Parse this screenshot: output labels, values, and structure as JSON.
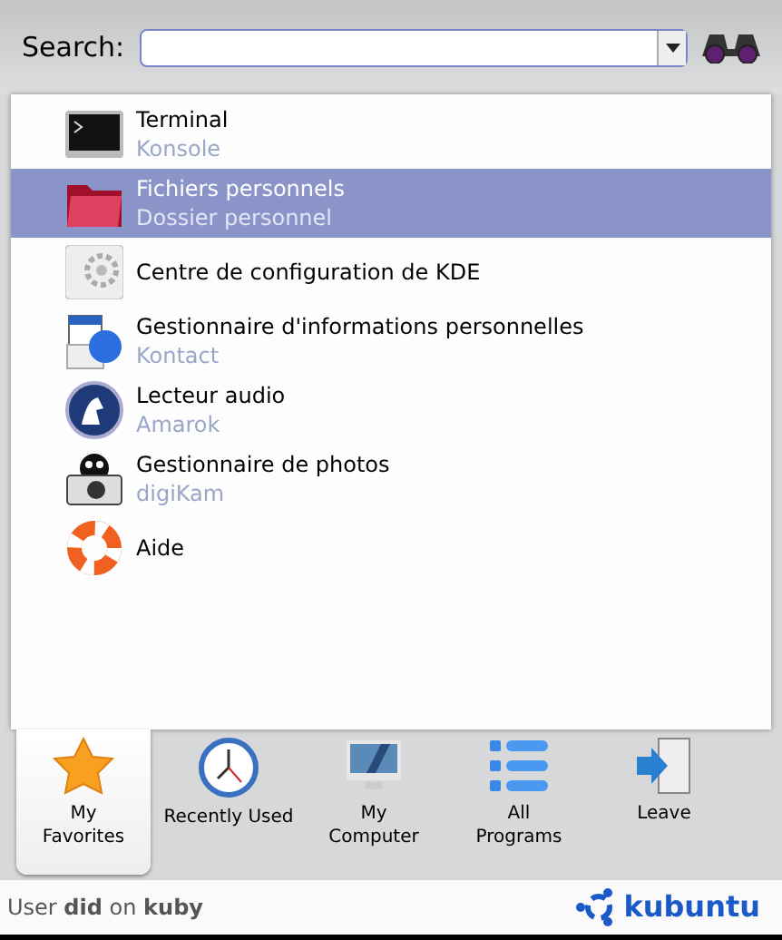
{
  "search": {
    "label": "Search:"
  },
  "items": [
    {
      "title": "Terminal",
      "subtitle": "Konsole",
      "selected": false
    },
    {
      "title": "Fichiers personnels",
      "subtitle": "Dossier personnel",
      "selected": true
    },
    {
      "title": "Centre de configuration de KDE",
      "selected": false
    },
    {
      "title": "Gestionnaire d'informations personnelles",
      "subtitle": "Kontact",
      "selected": false
    },
    {
      "title": "Lecteur audio",
      "subtitle": "Amarok",
      "selected": false
    },
    {
      "title": "Gestionnaire de photos",
      "subtitle": "digiKam",
      "selected": false
    },
    {
      "title": "Aide",
      "selected": false
    }
  ],
  "tabs": [
    {
      "label": "My Favorites",
      "selected": true
    },
    {
      "label": "Recently Used",
      "selected": false
    },
    {
      "label": "My Computer",
      "selected": false
    },
    {
      "label": "All Programs",
      "selected": false
    },
    {
      "label": "Leave",
      "selected": false
    }
  ],
  "status": {
    "text": "User **did** on **kuby**",
    "brand": "kubuntu"
  }
}
